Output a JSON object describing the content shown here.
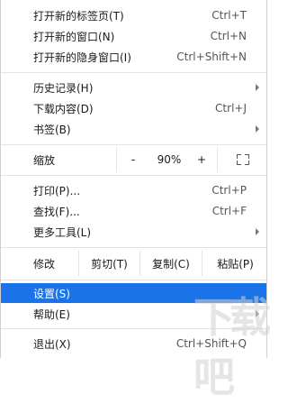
{
  "menu": {
    "new_tab": {
      "label": "打开新的标签页(T)",
      "shortcut": "Ctrl+T"
    },
    "new_window": {
      "label": "打开新的窗口(N)",
      "shortcut": "Ctrl+N"
    },
    "new_incognito": {
      "label": "打开新的隐身窗口(I)",
      "shortcut": "Ctrl+Shift+N"
    },
    "history": {
      "label": "历史记录(H)"
    },
    "downloads": {
      "label": "下载内容(D)",
      "shortcut": "Ctrl+J"
    },
    "bookmarks": {
      "label": "书签(B)"
    },
    "zoom": {
      "label": "缩放",
      "minus": "-",
      "value": "90%",
      "plus": "+"
    },
    "print": {
      "label": "打印(P)...",
      "shortcut": "Ctrl+P"
    },
    "find": {
      "label": "查找(F)...",
      "shortcut": "Ctrl+F"
    },
    "more_tools": {
      "label": "更多工具(L)"
    },
    "edit": {
      "label": "修改",
      "cut": "剪切(T)",
      "copy": "复制(C)",
      "paste": "粘贴(P)"
    },
    "settings": {
      "label": "设置(S)"
    },
    "help": {
      "label": "帮助(E)"
    },
    "exit": {
      "label": "退出(X)",
      "shortcut": "Ctrl+Shift+Q"
    }
  },
  "colors": {
    "selected": "#1a73e8"
  },
  "watermark": "下载吧"
}
